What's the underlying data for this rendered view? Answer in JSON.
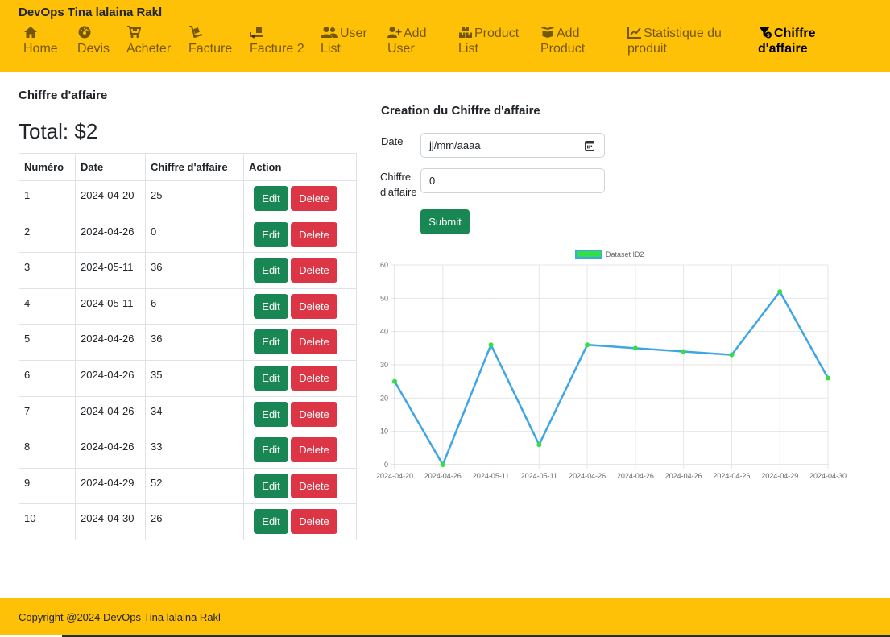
{
  "brand": "DevOps Tina lalaina Rakl",
  "nav": [
    {
      "line1": "Home",
      "line2": "",
      "icon": "home-icon"
    },
    {
      "line1": "Devis",
      "line2": "",
      "icon": "gauge-icon"
    },
    {
      "line1": "Acheter",
      "line2": "",
      "icon": "cart-icon"
    },
    {
      "line1": "Facture",
      "line2": "",
      "icon": "dolly-icon"
    },
    {
      "line1": "Facture 2",
      "line2": "",
      "icon": "truck-loading-icon"
    },
    {
      "line1": "User",
      "line2": "List",
      "icon": "users-icon"
    },
    {
      "line1": "Add",
      "line2": "User",
      "icon": "user-plus-icon"
    },
    {
      "line1": "Product",
      "line2": "List",
      "icon": "boxes-icon"
    },
    {
      "line1": "Add",
      "line2": "Product",
      "icon": "box-open-icon"
    },
    {
      "line1": "Statistique du",
      "line2": "produit",
      "icon": "chart-line-icon"
    },
    {
      "line1": "Chiffre",
      "line2": "d'affaire",
      "icon": "filter-money-icon"
    }
  ],
  "left": {
    "heading": "Chiffre d'affaire",
    "total": "Total: $2",
    "columns": [
      "Numéro",
      "Date",
      "Chiffre d'affaire",
      "Action"
    ],
    "edit_label": "Edit",
    "delete_label": "Delete",
    "rows": [
      {
        "num": "1",
        "date": "2024-04-20",
        "ca": "25"
      },
      {
        "num": "2",
        "date": "2024-04-26",
        "ca": "0"
      },
      {
        "num": "3",
        "date": "2024-05-11",
        "ca": "36"
      },
      {
        "num": "4",
        "date": "2024-05-11",
        "ca": "6"
      },
      {
        "num": "5",
        "date": "2024-04-26",
        "ca": "36"
      },
      {
        "num": "6",
        "date": "2024-04-26",
        "ca": "35"
      },
      {
        "num": "7",
        "date": "2024-04-26",
        "ca": "34"
      },
      {
        "num": "8",
        "date": "2024-04-26",
        "ca": "33"
      },
      {
        "num": "9",
        "date": "2024-04-29",
        "ca": "52"
      },
      {
        "num": "10",
        "date": "2024-04-30",
        "ca": "26"
      }
    ]
  },
  "form": {
    "heading": "Creation du Chiffre d'affaire",
    "date_label": "Date",
    "date_placeholder": "jj/mm/aaaa",
    "ca_label_line1": "Chiffre",
    "ca_label_line2": "d'affaire",
    "ca_value": "0",
    "submit_label": "Submit"
  },
  "chart_data": {
    "type": "line",
    "categories": [
      "2024-04-20",
      "2024-04-26",
      "2024-05-11",
      "2024-05-11",
      "2024-04-26",
      "2024-04-26",
      "2024-04-26",
      "2024-04-26",
      "2024-04-29",
      "2024-04-30"
    ],
    "series": [
      {
        "name": "Dataset ID2",
        "values": [
          25,
          0,
          36,
          6,
          36,
          35,
          34,
          33,
          52,
          26
        ],
        "line_color": "#3ea5e6",
        "point_color": "#33e044"
      }
    ],
    "ylim": [
      0,
      60
    ],
    "yticks": [
      "0",
      "10",
      "20",
      "30",
      "40",
      "50",
      "60"
    ],
    "grid": true,
    "legend": "top"
  },
  "footer": "Copyright @2024 DevOps Tina lalaina Rakl",
  "colors": {
    "navbar": "#ffc107",
    "success": "#198754",
    "danger": "#dc3545"
  }
}
